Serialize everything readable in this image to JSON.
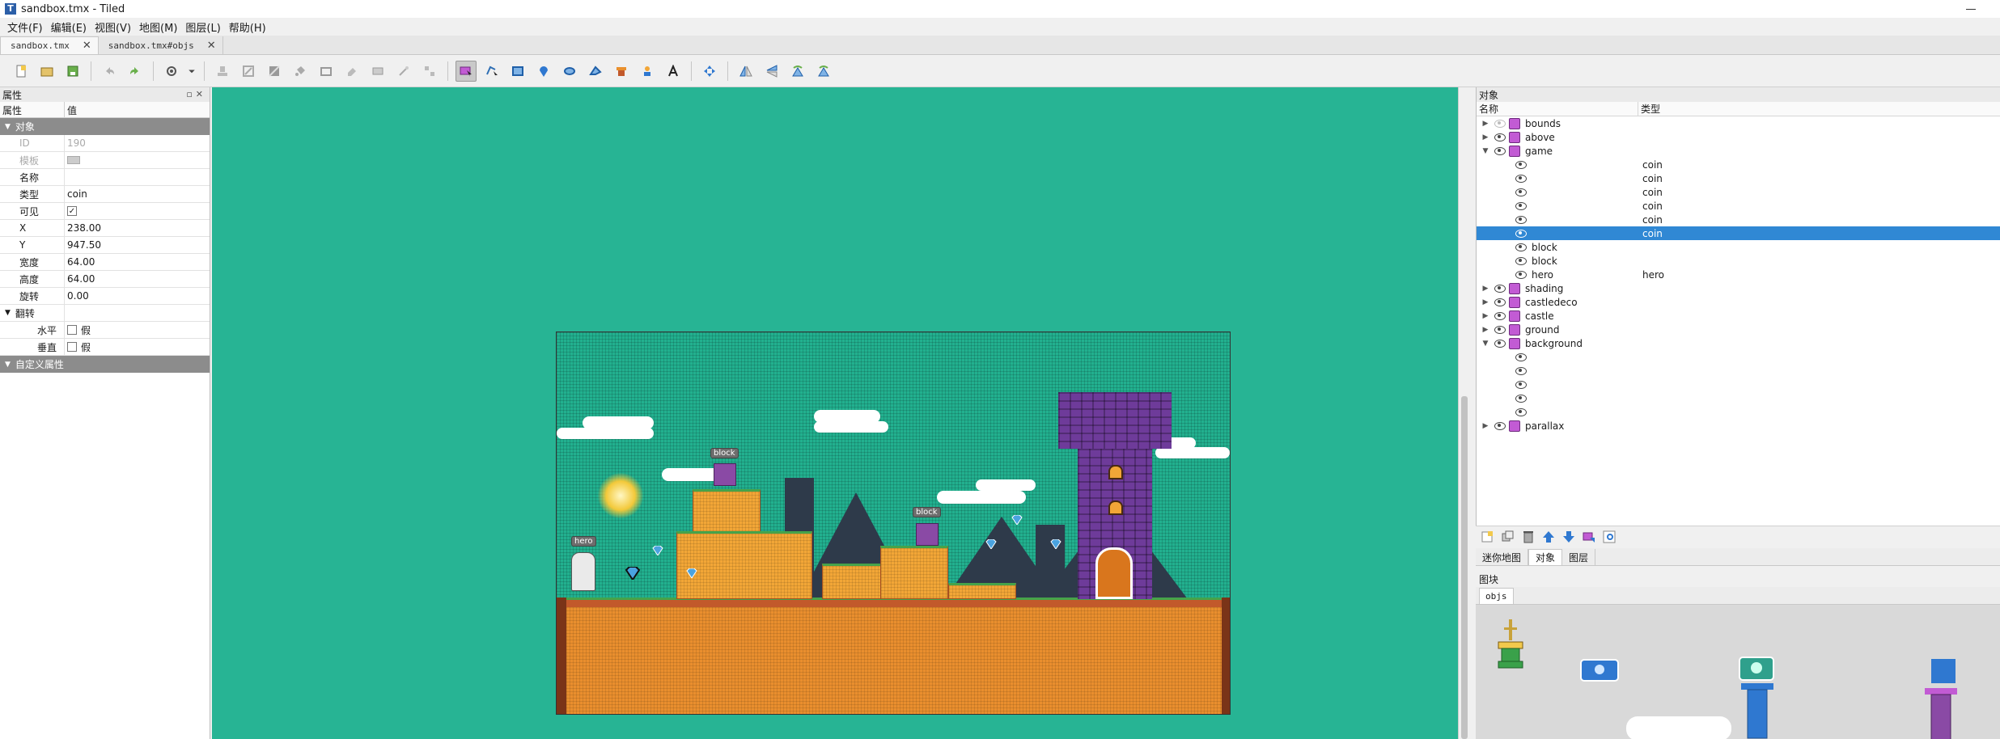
{
  "window": {
    "title": "sandbox.tmx - Tiled",
    "app_icon": "T"
  },
  "menu": [
    "文件(F)",
    "编辑(E)",
    "视图(V)",
    "地图(M)",
    "图层(L)",
    "帮助(H)"
  ],
  "tabs": [
    {
      "label": "sandbox.tmx",
      "close": "✕"
    },
    {
      "label": "sandbox.tmx#objs",
      "close": "✕"
    }
  ],
  "properties_panel": {
    "title": "属性",
    "columns": {
      "name": "属性",
      "value": "值"
    },
    "group_object": "对象",
    "rows": [
      {
        "key": "ID",
        "value": "190"
      },
      {
        "key": "模板",
        "value": ""
      },
      {
        "key": "名称",
        "value": ""
      },
      {
        "key": "类型",
        "value": "coin"
      },
      {
        "key": "可见",
        "value": "✓"
      },
      {
        "key": "X",
        "value": "238.00"
      },
      {
        "key": "Y",
        "value": "947.50"
      },
      {
        "key": "宽度",
        "value": "64.00"
      },
      {
        "key": "高度",
        "value": "64.00"
      },
      {
        "key": "旋转",
        "value": "0.00"
      }
    ],
    "group_flip": "翻转",
    "flip_rows": [
      {
        "key": "水平",
        "value": "假"
      },
      {
        "key": "垂直",
        "value": "假"
      }
    ],
    "group_custom": "自定义属性"
  },
  "map_labels": {
    "block1": "block",
    "block2": "block",
    "hero": "hero"
  },
  "objects_panel": {
    "title": "对象",
    "columns": {
      "name": "名称",
      "type": "类型"
    },
    "rows": [
      {
        "kind": "layer",
        "name": "bounds",
        "type": "",
        "expand": "▶"
      },
      {
        "kind": "layer",
        "name": "above",
        "type": "",
        "expand": "▶"
      },
      {
        "kind": "layer",
        "name": "game",
        "type": "",
        "expand": "▼"
      },
      {
        "kind": "obj",
        "name": "",
        "type": "coin"
      },
      {
        "kind": "obj",
        "name": "",
        "type": "coin"
      },
      {
        "kind": "obj",
        "name": "",
        "type": "coin"
      },
      {
        "kind": "obj",
        "name": "",
        "type": "coin"
      },
      {
        "kind": "obj",
        "name": "",
        "type": "coin"
      },
      {
        "kind": "obj",
        "name": "",
        "type": "coin",
        "selected": true
      },
      {
        "kind": "obj",
        "name": "block",
        "type": ""
      },
      {
        "kind": "obj",
        "name": "block",
        "type": ""
      },
      {
        "kind": "obj",
        "name": "hero",
        "type": "hero"
      },
      {
        "kind": "layer",
        "name": "shading",
        "type": "",
        "expand": "▶"
      },
      {
        "kind": "layer",
        "name": "castledeco",
        "type": "",
        "expand": "▶"
      },
      {
        "kind": "layer",
        "name": "castle",
        "type": "",
        "expand": "▶"
      },
      {
        "kind": "layer",
        "name": "ground",
        "type": "",
        "expand": "▶"
      },
      {
        "kind": "layer",
        "name": "background",
        "type": "",
        "expand": "▼"
      },
      {
        "kind": "obj",
        "name": "",
        "type": ""
      },
      {
        "kind": "obj",
        "name": "",
        "type": ""
      },
      {
        "kind": "obj",
        "name": "",
        "type": ""
      },
      {
        "kind": "obj",
        "name": "",
        "type": ""
      },
      {
        "kind": "obj",
        "name": "",
        "type": ""
      },
      {
        "kind": "layer",
        "name": "parallax",
        "type": "",
        "expand": "▶"
      }
    ]
  },
  "bottom_tabs": [
    "迷你地图",
    "对象",
    "图层"
  ],
  "tileset": {
    "title": "图块",
    "tab": "objs"
  },
  "colors": {
    "canvas_bg": "#27b494",
    "selection": "#3088d4",
    "panel_group": "#8c8c8c"
  }
}
